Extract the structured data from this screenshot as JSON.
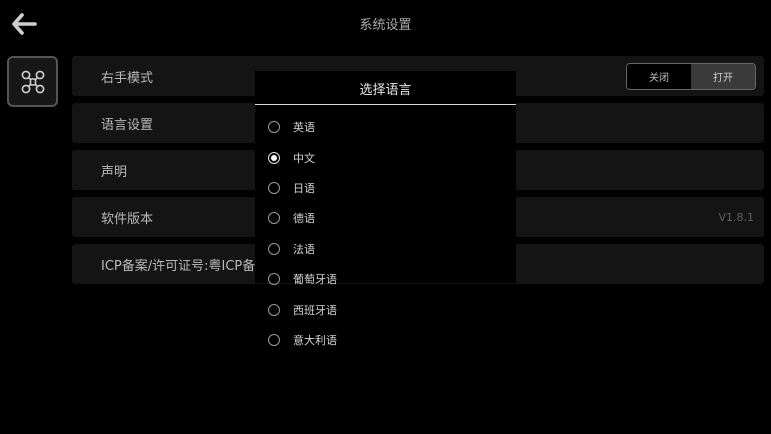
{
  "header": {
    "title": "系统设置",
    "back_icon": "arrow-left-icon"
  },
  "sidebar": {
    "drone_icon": "drone-icon"
  },
  "settings": {
    "right_hand_mode": {
      "label": "右手模式",
      "off_label": "关闭",
      "on_label": "打开",
      "selected": "打开"
    },
    "language": {
      "label": "语言设置"
    },
    "statement": {
      "label": "声明"
    },
    "software_version": {
      "label": "软件版本",
      "value": "V1.8.1"
    },
    "icp": {
      "label": "ICP备案/许可证号:粤ICP备"
    }
  },
  "language_dialog": {
    "title": "选择语言",
    "selected": "中文",
    "options": [
      {
        "label": "英语"
      },
      {
        "label": "中文"
      },
      {
        "label": "日语"
      },
      {
        "label": "德语"
      },
      {
        "label": "法语"
      },
      {
        "label": "葡萄牙语"
      },
      {
        "label": "西班牙语"
      },
      {
        "label": "意大利语"
      }
    ]
  },
  "colors": {
    "background": "#000000",
    "row_background": "#141414",
    "divider": "#d8d8d8"
  }
}
